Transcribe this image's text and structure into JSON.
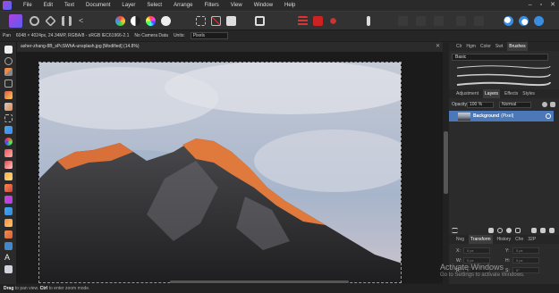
{
  "menubar": {
    "items": [
      "File",
      "Edit",
      "Text",
      "Document",
      "Layer",
      "Select",
      "Arrange",
      "Filters",
      "View",
      "Window",
      "Help"
    ],
    "window_controls": [
      "–",
      "▫",
      "✕"
    ]
  },
  "context_bar": {
    "tool": "Pan",
    "document_info": "6048 × 4024px, 24.34MP, RGBA/8 - sRGB IEC61966-2.1",
    "camera": "No Camera Data",
    "units_label": "Units:",
    "units_value": "Pixels"
  },
  "document_tab": {
    "title": "asher-zhang-8B_sPcSWhA-unsplash.jpg [Modified] (14.8%)",
    "close": "✕"
  },
  "right_panel": {
    "top_tabs": [
      "Clr",
      "Hgm",
      "Color",
      "Swt",
      "Brushes"
    ],
    "active_top_tab": "Brushes",
    "brush_category": "Basic",
    "mid_tabs": [
      "Adjustment",
      "Layers",
      "Effects",
      "Styles"
    ],
    "active_mid_tab": "Layers",
    "opacity_label": "Opacity:",
    "opacity_value": "100 %",
    "blend_mode": "Normal",
    "layer_name": "Background",
    "layer_type": "(Pixel)",
    "bottom_tabs": [
      "Nvg",
      "Transform",
      "History",
      "Chn",
      "32P"
    ],
    "active_bottom_tab": "Transform",
    "transform_fields": [
      {
        "label": "X:",
        "value": "0 px"
      },
      {
        "label": "Y:",
        "value": "0 px"
      },
      {
        "label": "W:",
        "value": "0 px"
      },
      {
        "label": "H:",
        "value": "0 px"
      },
      {
        "label": "R:",
        "value": "0°"
      },
      {
        "label": "S:",
        "value": "0°"
      }
    ]
  },
  "watermark": {
    "line1": "Activate Windows",
    "line2": "Go to Settings to activate Windows."
  },
  "statusbar": {
    "key1": "Drag",
    "text1": " to pan view. ",
    "key2": "Ctrl",
    "text2": " to enter zoom mode."
  },
  "colors": {
    "accent": "#4a78b8",
    "sky": "#b9c3d6",
    "peak_light": "#e07a3c",
    "rock": "#2e2e30"
  }
}
